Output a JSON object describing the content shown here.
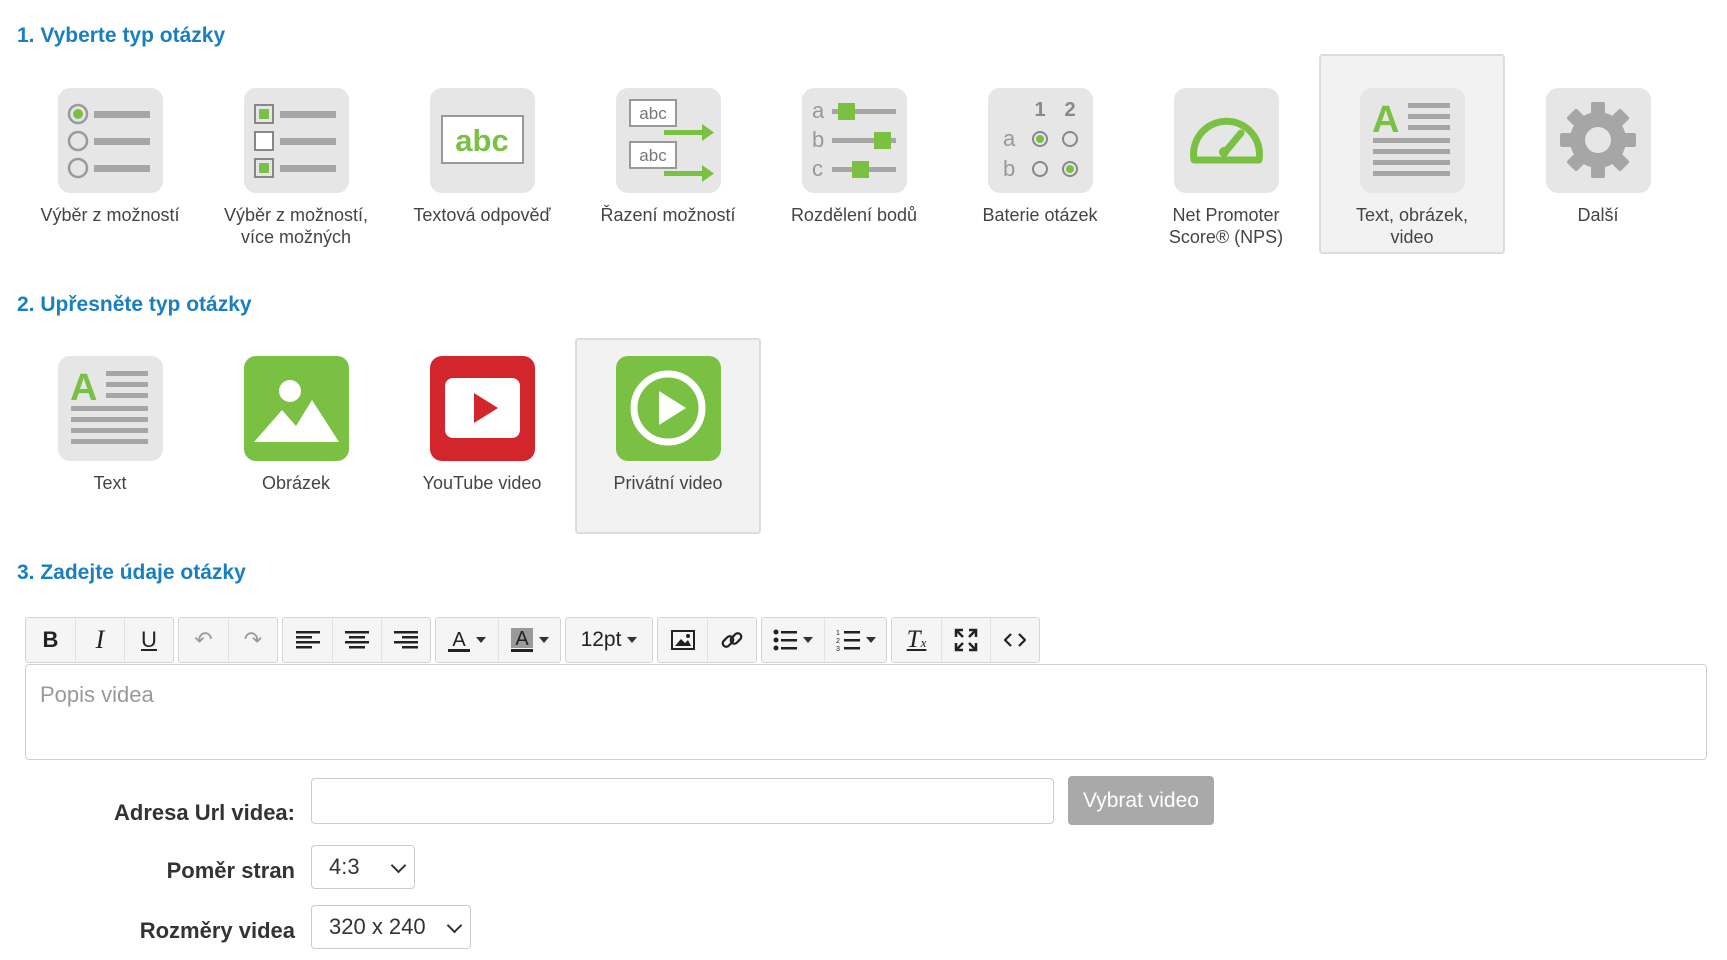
{
  "section1": {
    "title": "1. Vyberte typ otázky"
  },
  "question_types": [
    {
      "label": "Výběr z možností",
      "icon": "single-choice-icon"
    },
    {
      "label": "Výběr z možností,\nvíce možných",
      "icon": "multiple-choice-icon"
    },
    {
      "label": "Textová odpověď",
      "icon": "text-answer-icon"
    },
    {
      "label": "Řazení možností",
      "icon": "ranking-icon"
    },
    {
      "label": "Rozdělení bodů",
      "icon": "points-distribution-icon"
    },
    {
      "label": "Baterie otázek",
      "icon": "question-matrix-icon"
    },
    {
      "label": "Net Promoter\nScore® (NPS)",
      "icon": "nps-gauge-icon"
    },
    {
      "label": "Text, obrázek,\nvideo",
      "icon": "text-image-video-icon",
      "selected": true
    },
    {
      "label": "Další",
      "icon": "gear-icon"
    }
  ],
  "section2": {
    "title": "2. Upřesněte typ otázky"
  },
  "subtypes": [
    {
      "label": "Text",
      "icon": "text-icon"
    },
    {
      "label": "Obrázek",
      "icon": "image-icon"
    },
    {
      "label": "YouTube video",
      "icon": "youtube-icon"
    },
    {
      "label": "Privátní video",
      "icon": "play-video-icon",
      "selected": true
    }
  ],
  "section3": {
    "title": "3. Zadejte údaje otázky"
  },
  "toolbar": {
    "font_size": "12pt"
  },
  "editor": {
    "placeholder": "Popis videa"
  },
  "form": {
    "url_label": "Adresa Url videa:",
    "url_value": "",
    "pick_button": "Vybrat video",
    "ratio_label": "Poměr stran",
    "ratio_value": "4:3",
    "size_label": "Rozměry videa",
    "size_value": "320 x 240"
  },
  "colors": {
    "accent": "#1a7fc1",
    "green": "#7ac143",
    "red": "#d3262c",
    "tile_bg": "#e6e6e6",
    "icon_gray": "#a6a6a6"
  }
}
